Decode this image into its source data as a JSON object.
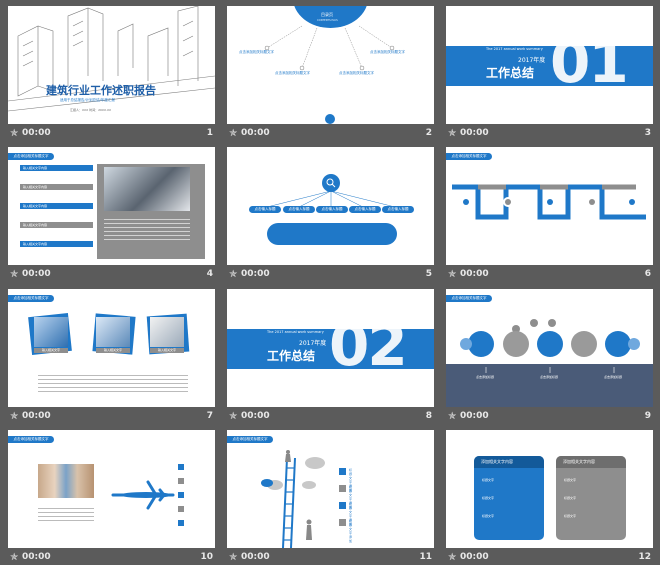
{
  "slides": [
    {
      "num": "1",
      "dur": "00:00",
      "title": "建筑行业工作述职报告",
      "subtitle": "适用于总结报告/计划总结/年度汇报",
      "footer": "汇报人：XXX  时间：20XX.XX"
    },
    {
      "num": "2",
      "dur": "00:00",
      "center_title": "目录页",
      "center_sub": "CONTENTS PLUS",
      "items": [
        "点击添加相关标题文字",
        "点击添加相关标题文字",
        "点击添加相关标题文字",
        "点击添加相关标题文字"
      ]
    },
    {
      "num": "3",
      "dur": "00:00",
      "tag": "The 2017 annual work summary",
      "year": "2017年度",
      "title": "工作总结",
      "big": "01"
    },
    {
      "num": "4",
      "dur": "00:00",
      "header": "点击添加相关标题文字",
      "items": [
        "输入相关文字内容",
        "输入相关文字内容",
        "输入相关文字内容",
        "输入相关文字内容",
        "输入相关文字内容"
      ]
    },
    {
      "num": "5",
      "dur": "00:00",
      "nodes": [
        "点击输入标题",
        "点击输入标题",
        "点击输入标题",
        "点击输入标题",
        "点击输入标题"
      ]
    },
    {
      "num": "6",
      "dur": "00:00",
      "header": "点击添加相关标题文字"
    },
    {
      "num": "7",
      "dur": "00:00",
      "header": "点击添加相关标题文字",
      "captions": [
        "输入相关文字",
        "输入相关文字",
        "输入相关文字"
      ]
    },
    {
      "num": "8",
      "dur": "00:00",
      "tag": "The 2017 annual work summary",
      "year": "2017年度",
      "title": "工作总结",
      "big": "02"
    },
    {
      "num": "9",
      "dur": "00:00",
      "header": "点击添加相关标题文字",
      "labels": [
        "点击添加标题",
        "点击添加标题",
        "点击添加标题"
      ]
    },
    {
      "num": "10",
      "dur": "00:00",
      "header": "点击添加相关标题文字"
    },
    {
      "num": "11",
      "dur": "00:00",
      "header": "点击添加相关标题文字",
      "labels": [
        "标题文字添加",
        "标题文字添加",
        "标题文字添加",
        "标题文字添加"
      ]
    },
    {
      "num": "12",
      "dur": "00:00",
      "header": "点击添加相关标题文字",
      "left_title": "添加相关文字内容",
      "right_title": "添加相关文字内容",
      "left_items": [
        "标题文字",
        "标题文字",
        "标题文字"
      ],
      "right_items": [
        "标题文字",
        "标题文字",
        "标题文字"
      ]
    }
  ],
  "colors": {
    "accent": "#1f78c8",
    "gray": "#8e8e8e",
    "background": "#5b5b5b"
  }
}
